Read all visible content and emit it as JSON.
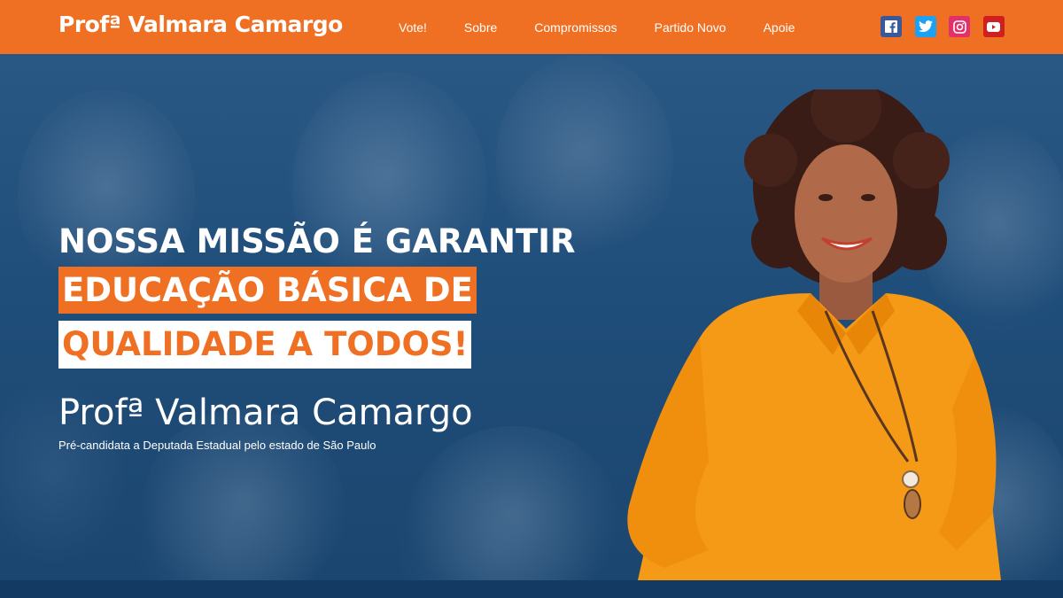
{
  "header": {
    "logo": "Profª Valmara Camargo",
    "nav": [
      "Vote!",
      "Sobre",
      "Compromissos",
      "Partido Novo",
      "Apoie"
    ],
    "social": [
      {
        "icon": "facebook-icon",
        "color": "#3b5998"
      },
      {
        "icon": "twitter-icon",
        "color": "#1da1f2"
      },
      {
        "icon": "instagram-icon",
        "color": "#e1306c"
      },
      {
        "icon": "youtube-icon",
        "color": "#cd201f"
      }
    ]
  },
  "hero": {
    "headline_line1": "NOSSA MISSÃO É GARANTIR",
    "headline_line2": "EDUCAÇÃO BÁSICA DE",
    "headline_line3": "QUALIDADE A TODOS!",
    "name": "Profª Valmara Camargo",
    "subtitle": "Pré-candidata a Deputada Estadual pelo estado de São Paulo"
  },
  "colors": {
    "brand_orange": "#f07023",
    "hero_blue": "#1f4d79",
    "white": "#ffffff"
  }
}
